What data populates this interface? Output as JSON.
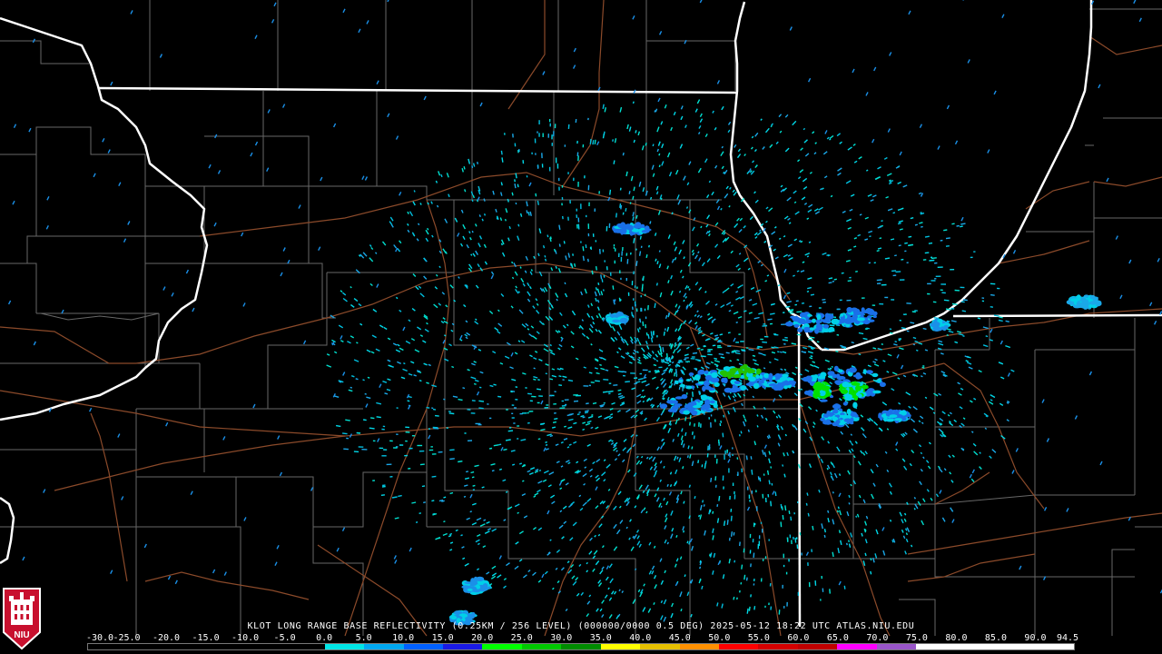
{
  "caption": {
    "text": "KLOT LONG RANGE BASE REFLECTIVITY (0.25KM / 256 LEVEL) (000000/0000 0.5 DEG) 2025-05-12 18:22 UTC  ATLAS.NIU.EDU"
  },
  "scale": {
    "labels": [
      "-30.0",
      "-25.0",
      "-20.0",
      "-15.0",
      "-10.0",
      "-5.0",
      "0.0",
      "5.0",
      "10.0",
      "15.0",
      "20.0",
      "25.0",
      "30.0",
      "35.0",
      "40.0",
      "45.0",
      "50.0",
      "55.0",
      "60.0",
      "65.0",
      "70.0",
      "75.0",
      "80.0",
      "85.0",
      "90.0",
      "94.5"
    ],
    "colors": [
      "#000000",
      "#000000",
      "#000000",
      "#000000",
      "#000000",
      "#000000",
      "#00e5e5",
      "#00a8f0",
      "#0060ff",
      "#1a1ae6",
      "#00ff00",
      "#00c800",
      "#008c00",
      "#ffff00",
      "#e6c000",
      "#ff9000",
      "#ff0000",
      "#d40000",
      "#c00000",
      "#ff00ff",
      "#9955c9",
      "#ffffff",
      "#ffffff",
      "#ffffff",
      "#ffffff"
    ]
  },
  "logo": {
    "text": "NIU",
    "color": "#c8102e"
  }
}
